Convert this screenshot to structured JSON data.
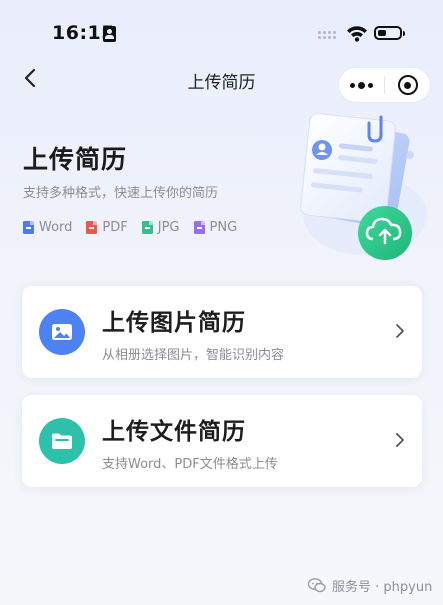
{
  "status_bar": {
    "time": "16:15"
  },
  "nav": {
    "title": "上传简历"
  },
  "hero": {
    "title": "上传简历",
    "subtitle": "支持多种格式，快速上传你的简历",
    "formats": [
      {
        "label": "Word",
        "color": "#4a7bf0"
      },
      {
        "label": "PDF",
        "color": "#f0574a"
      },
      {
        "label": "JPG",
        "color": "#34c08a"
      },
      {
        "label": "PNG",
        "color": "#9a6cf0"
      }
    ]
  },
  "options": [
    {
      "title": "上传图片简历",
      "description": "从相册选择图片，智能识别内容",
      "icon": "image-icon",
      "color": "#4c82f2"
    },
    {
      "title": "上传文件简历",
      "description": "支持Word、PDF文件格式上传",
      "icon": "folder-icon",
      "color": "#2dc1ab"
    }
  ],
  "watermark": {
    "text": "服务号 · phpyun"
  },
  "colors": {
    "accent_green": "#2ecb8a",
    "background": "#eef1fa"
  }
}
